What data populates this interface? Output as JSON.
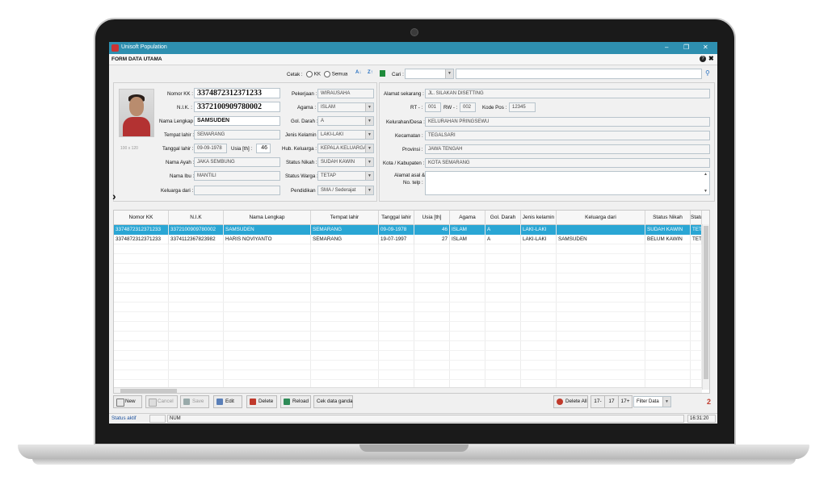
{
  "window": {
    "title": "Unisoft Population",
    "minimize": "–",
    "restore": "❐",
    "close": "✕"
  },
  "form": {
    "title": "FORM DATA UTAMA",
    "help": "?",
    "close": "✖"
  },
  "topbar": {
    "cetak_label": "Cetak :",
    "opt_kk": "KK",
    "opt_semua": "Semua",
    "cari_label": "Cari :",
    "cari_value": "",
    "search_value": ""
  },
  "photo_caption": "100 x 120",
  "left": {
    "nomor_kk_label": "Nomor KK :",
    "nomor_kk": "3374872312371233",
    "nik_label": "N.I.K. :",
    "nik": "3372100909780002",
    "nama_label": "Nama Lengkap :",
    "nama": "SAMSUDEN",
    "tempat_lahir_label": "Tempat lahir :",
    "tempat_lahir": "SEMARANG",
    "tanggal_lahir_label": "Tanggal lahir :",
    "tanggal_lahir": "09-09-1978",
    "usia_label": "Usia [th] :",
    "usia": "46",
    "nama_ayah_label": "Nama Ayah :",
    "nama_ayah": "JAKA SEMBUNG",
    "nama_ibu_label": "Nama Ibu :",
    "nama_ibu": "MANTILI",
    "keluarga_dari_label": "Keluarga dari :",
    "keluarga_dari": ""
  },
  "middle": {
    "pekerjaan_label": "Pekerjaan :",
    "pekerjaan": "WIRAUSAHA",
    "agama_label": "Agama :",
    "agama": "ISLAM",
    "gol_darah_label": "Gol. Darah :",
    "gol_darah": "A",
    "jenis_kelamin_label": "Jenis Kelamin :",
    "jenis_kelamin": "LAKI-LAKI",
    "hub_keluarga_label": "Hub. Keluarga :",
    "hub_keluarga": "KEPALA KELUARGA",
    "status_nikah_label": "Status Nikah :",
    "status_nikah": "SUDAH KAWIN",
    "status_warga_label": "Status Warga :",
    "status_warga": "TETAP",
    "pendidikan_label": "Pendidikan :",
    "pendidikan": "SMA / Sederajat"
  },
  "right": {
    "alamat_label": "Alamat sekarang :",
    "alamat": "JL. SILAKAN DISETTING",
    "rt_label": "RT - :",
    "rt": "001",
    "rw_label": "RW - :",
    "rw": "002",
    "kodepos_label": "Kode Pos :",
    "kodepos": "12345",
    "kelurahan_label": "Kelurahan/Desa :",
    "kelurahan": "KELURAHAN PRINGSEWU",
    "kecamatan_label": "Kecamatan :",
    "kecamatan": "TEGALSARI",
    "provinsi_label": "Provinsi :",
    "provinsi": "JAWA TENGAH",
    "kota_label": "Kota / Kabupaten :",
    "kota": "KOTA SEMARANG",
    "alamat_asal_label1": "Alamat asal &",
    "alamat_asal_label2": "No. telp :",
    "alamat_asal": ""
  },
  "table": {
    "columns": [
      "Nomor KK",
      "N.I.K",
      "Nama Lengkap",
      "Tempat lahir",
      "Tanggal lahir",
      "Usia [th]",
      "Agama",
      "Gol. Darah",
      "Jenis kelamin",
      "Keluarga dari",
      "Status Nikah",
      "Statu"
    ],
    "rows": [
      [
        "3374872312371233",
        "3372100909780002",
        "SAMSUDEN",
        "SEMARANG",
        "09-09-1978",
        "46",
        "ISLAM",
        "A",
        "LAKI-LAKI",
        "",
        "SUDAH KAWIN",
        "TETA"
      ],
      [
        "3374872312371233",
        "3374112367823982",
        "HARIS NOVIYANTO",
        "SEMARANG",
        "19-07-1997",
        "27",
        "ISLAM",
        "A",
        "LAKI-LAKI",
        "SAMSUDEN",
        "BELUM KAWIN",
        "TETA"
      ]
    ]
  },
  "toolbar": {
    "new": "New",
    "cancel": "Cancel",
    "save": "Save",
    "edit": "Edit",
    "delete": "Delete",
    "reload": "Reload",
    "cek": "Cek data ganda",
    "delete_all": "Delete All",
    "f1": "17-",
    "f2": "17",
    "f3": "17+",
    "filter": "Filter Data",
    "count": "2"
  },
  "status": {
    "text": "Status aktif",
    "num": "NUM",
    "time": "16:31:20"
  },
  "colors": {
    "titlebar": "#2e8fb0",
    "selection": "#2aa6d4",
    "count": "#c0392b"
  }
}
